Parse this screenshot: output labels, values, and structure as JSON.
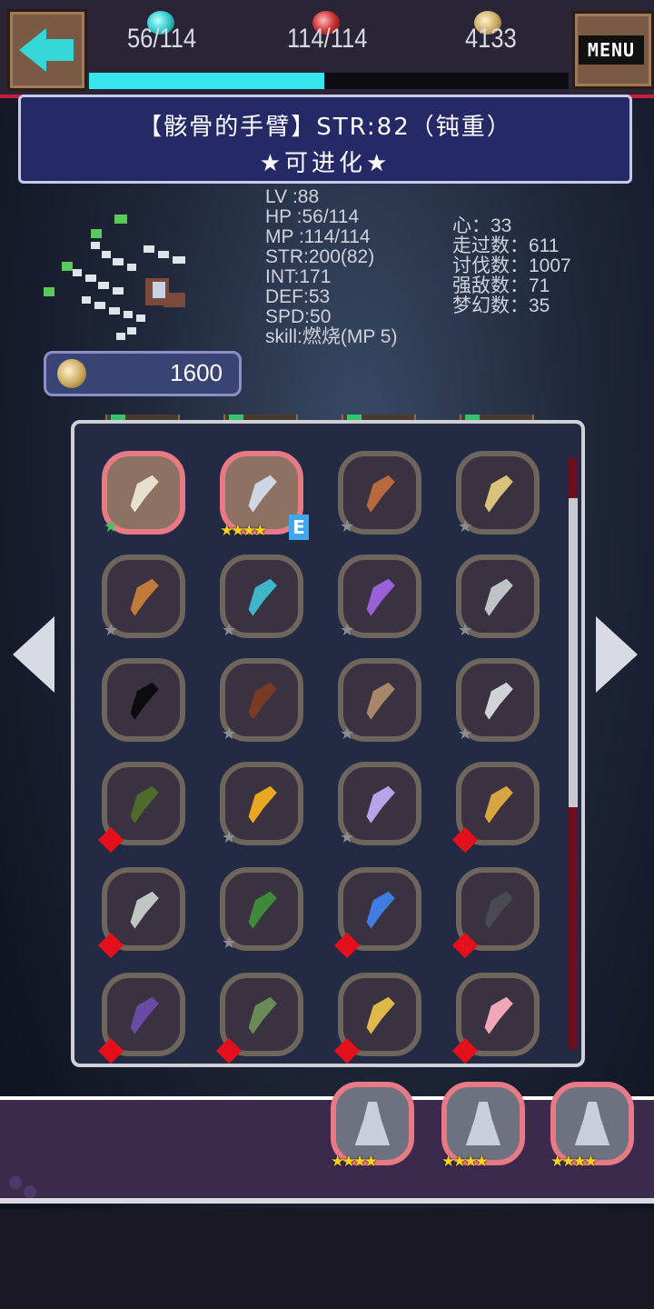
{
  "hud": {
    "hp": "56/114",
    "mp": "114/114",
    "gold": "4133",
    "hp_fraction": 0.49,
    "menu_label": "MENU"
  },
  "banner": {
    "line1": "【骸骨的手臂】STR:82（钝重）",
    "line2": "★可进化★"
  },
  "character": {
    "price": "1600",
    "stats_left": [
      "LV :88",
      "HP :56/114",
      "MP :114/114",
      "STR:200(82)",
      "INT:171",
      "DEF:53",
      "SPD:50",
      "skill:燃烧(MP 5)"
    ],
    "stats_right": [
      "心：33",
      "走过数：611",
      "讨伐数：1007",
      "强敌数：71",
      "梦幻数：35"
    ]
  },
  "inventory": {
    "slots": [
      {
        "icon": "skull-arm-icon",
        "color": "#e8e0d0",
        "status": "equipped-green"
      },
      {
        "icon": "skeleton-axe-icon",
        "color": "#cfd7e4",
        "status": "equipped-stars",
        "stars": "★★★★",
        "badge": "E"
      },
      {
        "icon": "bone-club-icon",
        "color": "#b86a3c",
        "status": "grey"
      },
      {
        "icon": "golden-staff-icon",
        "color": "#d9c27a",
        "status": "grey"
      },
      {
        "icon": "stone-hammer-icon",
        "color": "#c07a3a",
        "status": "grey"
      },
      {
        "icon": "ice-fang-icon",
        "color": "#3fb6c8",
        "status": "grey"
      },
      {
        "icon": "purple-claw-icon",
        "color": "#9b60d8",
        "status": "grey"
      },
      {
        "icon": "pickaxe-icon",
        "color": "#bfc3c8",
        "status": "grey"
      },
      {
        "icon": "dark-shield-icon",
        "color": "#0c0c10",
        "status": "none"
      },
      {
        "icon": "brown-hood-icon",
        "color": "#7a3a24",
        "status": "grey"
      },
      {
        "icon": "antler-icon",
        "color": "#a8866a",
        "status": "grey"
      },
      {
        "icon": "silver-blade-icon",
        "color": "#d0d3d8",
        "status": "grey"
      },
      {
        "icon": "moss-leaf-icon",
        "color": "#4e6a2c",
        "status": "red"
      },
      {
        "icon": "golden-key-icon",
        "color": "#e8a820",
        "status": "grey"
      },
      {
        "icon": "lavender-wing-icon",
        "color": "#b7a3e8",
        "status": "grey"
      },
      {
        "icon": "cross-wand-icon",
        "color": "#d7a640",
        "status": "red"
      },
      {
        "icon": "trident-icon",
        "color": "#bfc7c0",
        "status": "red"
      },
      {
        "icon": "green-dagger-icon",
        "color": "#3e8a3a",
        "status": "grey"
      },
      {
        "icon": "blue-gem-icon",
        "color": "#3f7ee0",
        "status": "red"
      },
      {
        "icon": "dark-scythe-icon",
        "color": "#4a4a52",
        "status": "red"
      },
      {
        "icon": "shadow-cloak-icon",
        "color": "#6a4aa2",
        "status": "red"
      },
      {
        "icon": "serpent-icon",
        "color": "#6a8a5a",
        "status": "red"
      },
      {
        "icon": "feather-bow-icon",
        "color": "#e0b84a",
        "status": "red"
      },
      {
        "icon": "pink-sword-icon",
        "color": "#f0a8b8",
        "status": "red"
      }
    ]
  },
  "equipped_tray": [
    {
      "icon": "helmet-figure-icon",
      "stars": "★★★★"
    },
    {
      "icon": "skeleton-figure-icon",
      "stars": "★★★★"
    },
    {
      "icon": "skull-staff-icon",
      "stars": "★★★★"
    }
  ]
}
